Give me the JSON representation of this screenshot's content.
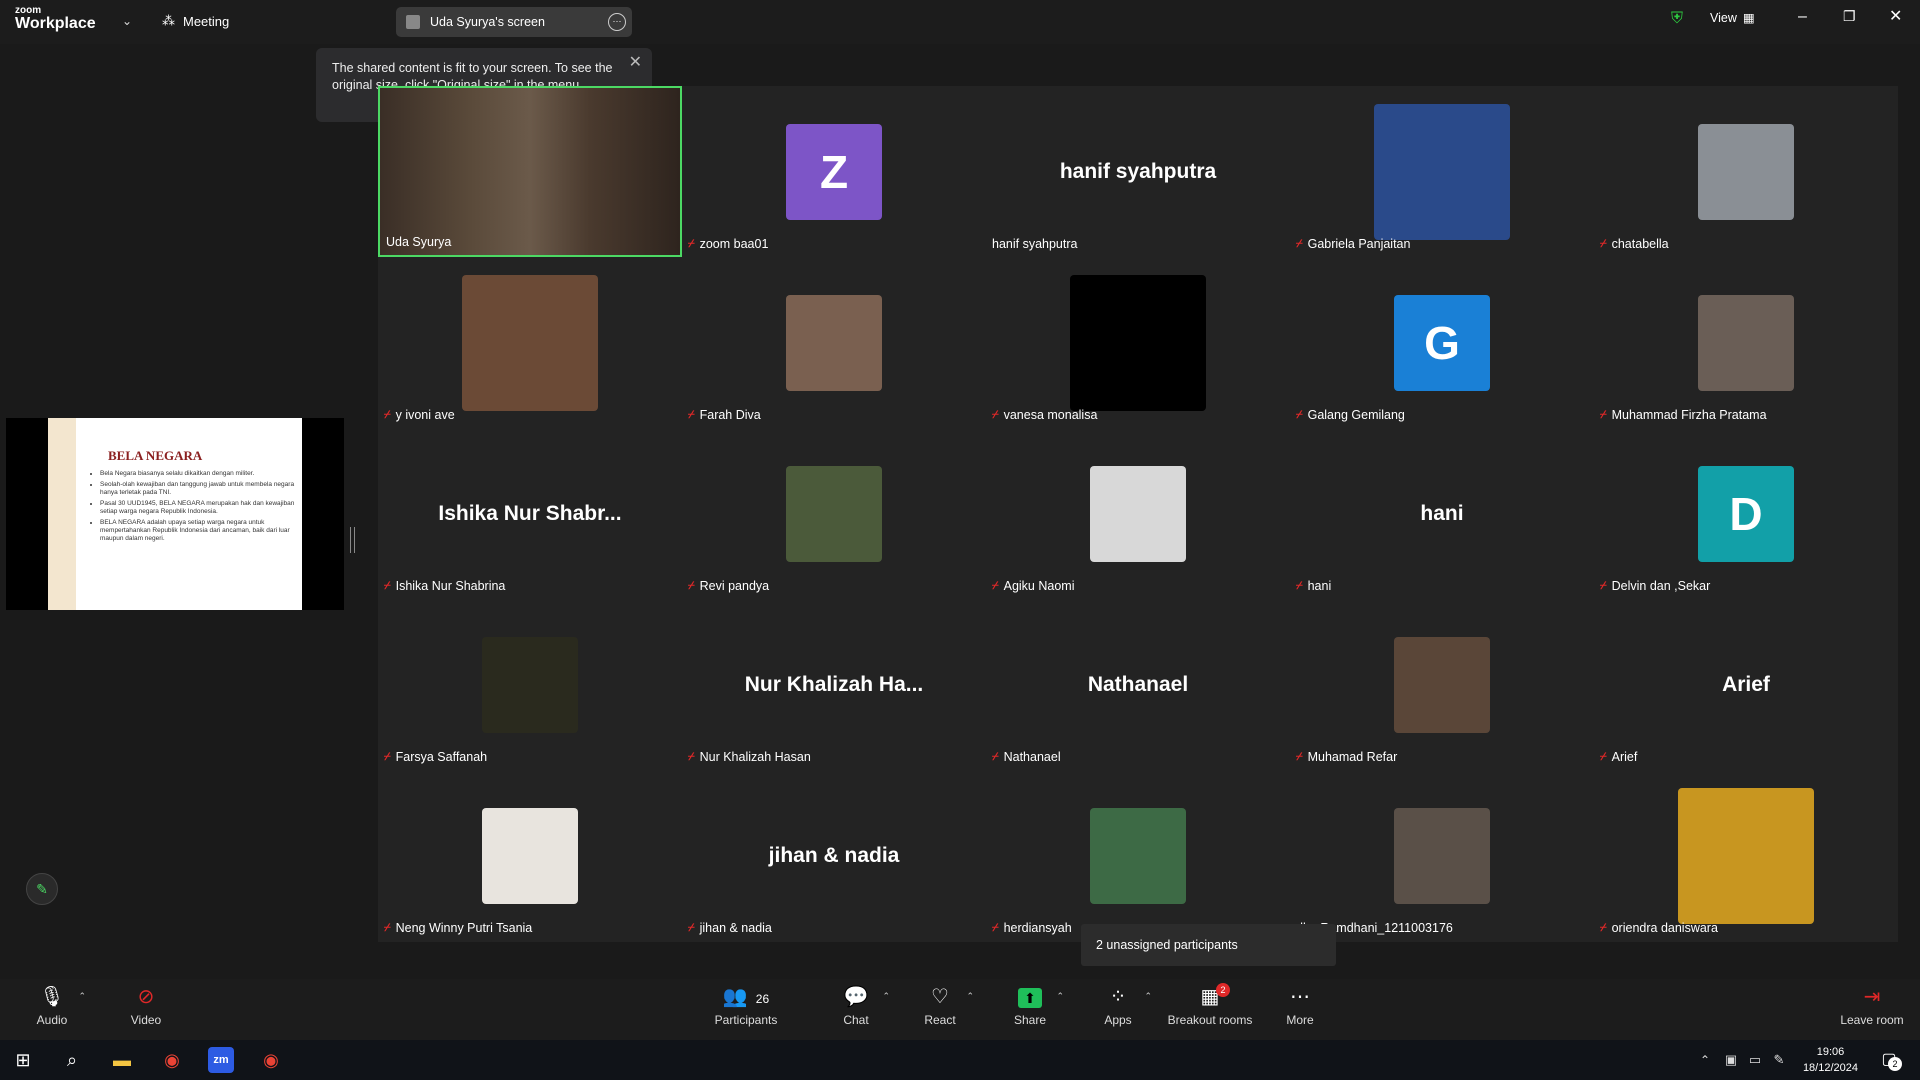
{
  "app": {
    "logo_small": "zoom",
    "logo_big": "Workplace",
    "meeting_label": "Meeting",
    "screen_title": "Uda Syurya's screen",
    "view_label": "View"
  },
  "tooltip": {
    "line1": "The shared content is fit to your screen. To see the",
    "line2": "original size, click \"Original size\" in the menu."
  },
  "slide": {
    "title": "BELA NEGARA",
    "bullets": [
      "Bela Negara biasanya selalu dikaitkan dengan militer.",
      "Seolah-olah kewajiban dan tanggung jawab untuk membela negara hanya terletak pada TNI.",
      "Pasal 30 UUD1945, BELA NEGARA merupakan hak dan kewajiban setiap warga negara Republik Indonesia.",
      "BELA NEGARA adalah upaya setiap warga negara untuk mempertahankan Republik Indonesia dari ancaman, baik dari luar maupun dalam negeri."
    ]
  },
  "participants": [
    {
      "name": "Uda Syurya",
      "type": "video",
      "active": true
    },
    {
      "name": "zoom baa01",
      "type": "avatar",
      "initial": "Z",
      "color": "#7d55c7",
      "muted": true
    },
    {
      "name": "hanif syahputra",
      "type": "name",
      "display": "hanif syahputra",
      "muted": false
    },
    {
      "name": "Gabriela Panjaitan",
      "type": "photo",
      "size": "big",
      "color": "#2a4a8a",
      "muted": true
    },
    {
      "name": "chatabella",
      "type": "photo",
      "size": "sq",
      "color": "#8a8f95",
      "muted": true
    },
    {
      "name": "y ivoni ave",
      "type": "photo",
      "size": "big",
      "color": "#6b4a36",
      "muted": true
    },
    {
      "name": "Farah Diva",
      "type": "photo",
      "size": "sq",
      "color": "#7a6050",
      "muted": true
    },
    {
      "name": "vanesa monalisa",
      "type": "photo",
      "size": "big",
      "color": "#000000",
      "muted": true
    },
    {
      "name": "Galang Gemilang",
      "type": "avatar",
      "initial": "G",
      "color": "#1a80d6",
      "muted": true
    },
    {
      "name": "Muhammad Firzha Pratama",
      "type": "photo",
      "size": "sq",
      "color": "#6a5e56",
      "muted": true
    },
    {
      "name": "Ishika Nur Shabrina",
      "type": "name",
      "display": "Ishika Nur Shabr...",
      "muted": true
    },
    {
      "name": "Revi pandya",
      "type": "photo",
      "size": "sq",
      "color": "#4b5a3a",
      "muted": true
    },
    {
      "name": "Agiku Naomi",
      "type": "photo",
      "size": "sq",
      "color": "#d8d8d8",
      "muted": true
    },
    {
      "name": "hani",
      "type": "name",
      "display": "hani",
      "muted": true
    },
    {
      "name": "Delvin dan ,Sekar",
      "type": "avatar",
      "initial": "D",
      "color": "#12a0a8",
      "muted": true
    },
    {
      "name": "Farsya Saffanah",
      "type": "photo",
      "size": "sq",
      "color": "#2a2a1e",
      "muted": true
    },
    {
      "name": "Nur Khalizah Hasan",
      "type": "name",
      "display": "Nur Khalizah Ha...",
      "muted": true
    },
    {
      "name": "Nathanael",
      "type": "name",
      "display": "Nathanael",
      "muted": true
    },
    {
      "name": "Muhamad Refar",
      "type": "photo",
      "size": "sq",
      "color": "#5a4638",
      "muted": true
    },
    {
      "name": "Arief",
      "type": "name",
      "display": "Arief",
      "muted": true
    },
    {
      "name": "Neng Winny Putri Tsania",
      "type": "photo",
      "size": "sq",
      "color": "#e8e4de",
      "muted": true
    },
    {
      "name": "jihan & nadia",
      "type": "name",
      "display": "jihan & nadia",
      "muted": true
    },
    {
      "name": "herdiansyah",
      "type": "photo",
      "size": "sq",
      "color": "#3d6a45",
      "muted": true
    },
    {
      "name": "dha Ramdhani_1211003176",
      "type": "photo",
      "size": "sq",
      "color": "#5a5048",
      "muted": false
    },
    {
      "name": "oriendra daniswara",
      "type": "photo",
      "size": "big",
      "color": "#c89620",
      "muted": true
    }
  ],
  "unassigned_text": "2 unassigned participants",
  "toolbar": {
    "audio": "Audio",
    "video": "Video",
    "participants": "Participants",
    "participants_count": "26",
    "chat": "Chat",
    "react": "React",
    "share": "Share",
    "apps": "Apps",
    "breakout": "Breakout rooms",
    "breakout_badge": "2",
    "more": "More",
    "leave": "Leave room"
  },
  "taskbar": {
    "time": "19:06",
    "date": "18/12/2024",
    "notif_count": "2"
  },
  "colors": {
    "active_border": "#4cd964",
    "muted_red": "#e02828",
    "share_green": "#1fbf5a"
  }
}
